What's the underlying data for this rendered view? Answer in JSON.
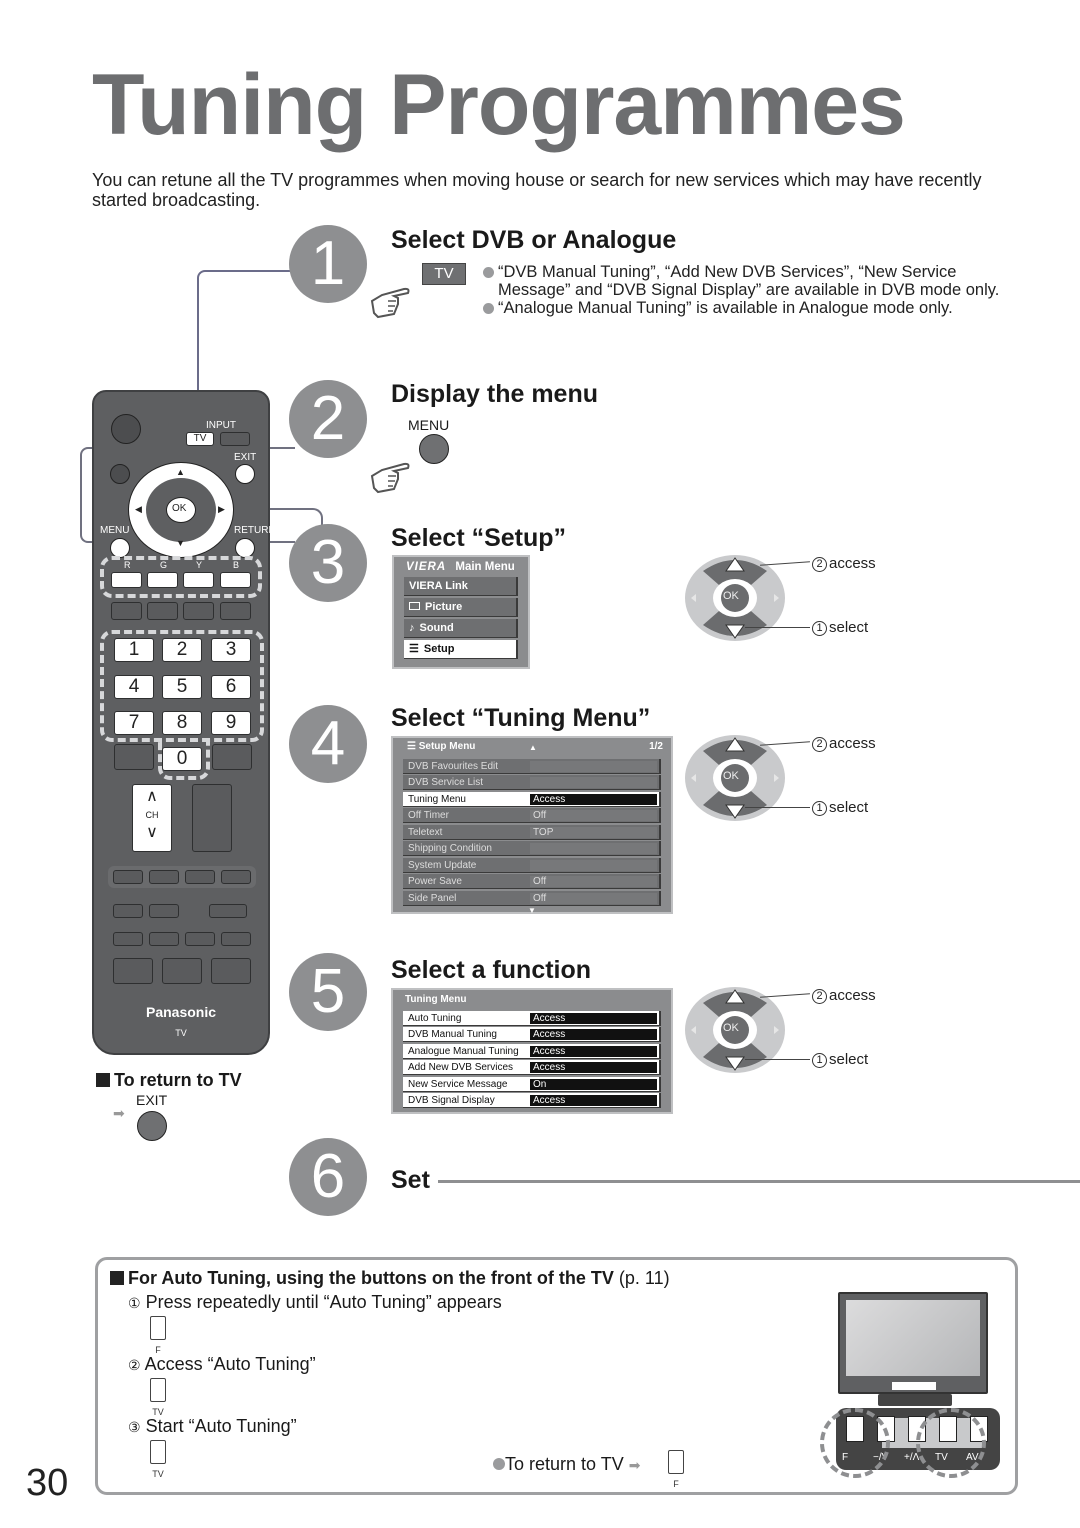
{
  "page": {
    "title": "Tuning Programmes",
    "intro": "You can retune all the TV programmes when moving house or search for new services which may have recently started broadcasting.",
    "page_number": "30"
  },
  "steps": [
    {
      "number": "1",
      "heading": "Select DVB or Analogue",
      "key_label": "TV",
      "bullets": [
        "“DVB Manual Tuning”, “Add New DVB Services”, “New Service Message” and “DVB Signal Display” are available in DVB mode only.",
        "“Analogue Manual Tuning” is available in Analogue mode only."
      ]
    },
    {
      "number": "2",
      "heading": "Display the menu",
      "key_label": "MENU"
    },
    {
      "number": "3",
      "heading": "Select “Setup”"
    },
    {
      "number": "4",
      "heading": "Select “Tuning Menu”"
    },
    {
      "number": "5",
      "heading": "Select a function"
    },
    {
      "number": "6",
      "heading": "Set"
    }
  ],
  "main_menu": {
    "logo": "VIERA",
    "title": "Main Menu",
    "items": [
      {
        "label": "VIERA Link",
        "icon": ""
      },
      {
        "label": "Picture",
        "icon": "screen-icon"
      },
      {
        "label": "Sound",
        "icon": "note-icon"
      },
      {
        "label": "Setup",
        "icon": "list-icon",
        "selected": true
      }
    ]
  },
  "setup_menu": {
    "title": "Setup Menu",
    "page": "1/2",
    "rows": [
      {
        "label": "DVB Favourites Edit",
        "value": ""
      },
      {
        "label": "DVB Service List",
        "value": ""
      },
      {
        "label": "Tuning Menu",
        "value": "Access",
        "selected": true
      },
      {
        "label": "Off Timer",
        "value": "Off"
      },
      {
        "label": "Teletext",
        "value": "TOP"
      },
      {
        "label": "Shipping Condition",
        "value": ""
      },
      {
        "label": "System Update",
        "value": ""
      },
      {
        "label": "Power Save",
        "value": "Off"
      },
      {
        "label": "Side Panel",
        "value": "Off"
      }
    ]
  },
  "tuning_menu": {
    "title": "Tuning Menu",
    "rows": [
      {
        "label": "Auto Tuning",
        "value": "Access"
      },
      {
        "label": "DVB Manual Tuning",
        "value": "Access"
      },
      {
        "label": "Analogue Manual Tuning",
        "value": "Access"
      },
      {
        "label": "Add New DVB Services",
        "value": "Access"
      },
      {
        "label": "New Service Message",
        "value": "On"
      },
      {
        "label": "DVB Signal Display",
        "value": "Access"
      }
    ]
  },
  "dpad": {
    "ok_label": "OK",
    "access_num": "2",
    "access_label": "access",
    "select_num": "1",
    "select_label": "select"
  },
  "remote": {
    "input_label": "INPUT",
    "tv_label": "TV",
    "exit_label": "EXIT",
    "ok_label": "OK",
    "menu_label": "MENU",
    "return_label": "RETURN",
    "color_keys": [
      "R",
      "G",
      "Y",
      "B"
    ],
    "digits": [
      "1",
      "2",
      "3",
      "4",
      "5",
      "6",
      "7",
      "8",
      "9",
      "0"
    ],
    "ch_label": "CH",
    "brand": "Panasonic",
    "model": "TV"
  },
  "return_to_tv": {
    "heading": "To return to TV",
    "key_label": "EXIT"
  },
  "auto_tuning_box": {
    "title": "For Auto Tuning, using the buttons on the front of the TV",
    "page_ref": "(p. 11)",
    "steps": [
      {
        "num": "①",
        "text": "Press repeatedly until “Auto Tuning” appears",
        "key": "F"
      },
      {
        "num": "②",
        "text": "Access “Auto Tuning”",
        "key": "TV"
      },
      {
        "num": "③",
        "text": "Start “Auto Tuning”",
        "key": "TV"
      }
    ],
    "return_text": "To return to TV",
    "return_key": "F",
    "tv_front_keys": [
      "F",
      "−/V",
      "+/Λ",
      "TV",
      "AV"
    ]
  }
}
